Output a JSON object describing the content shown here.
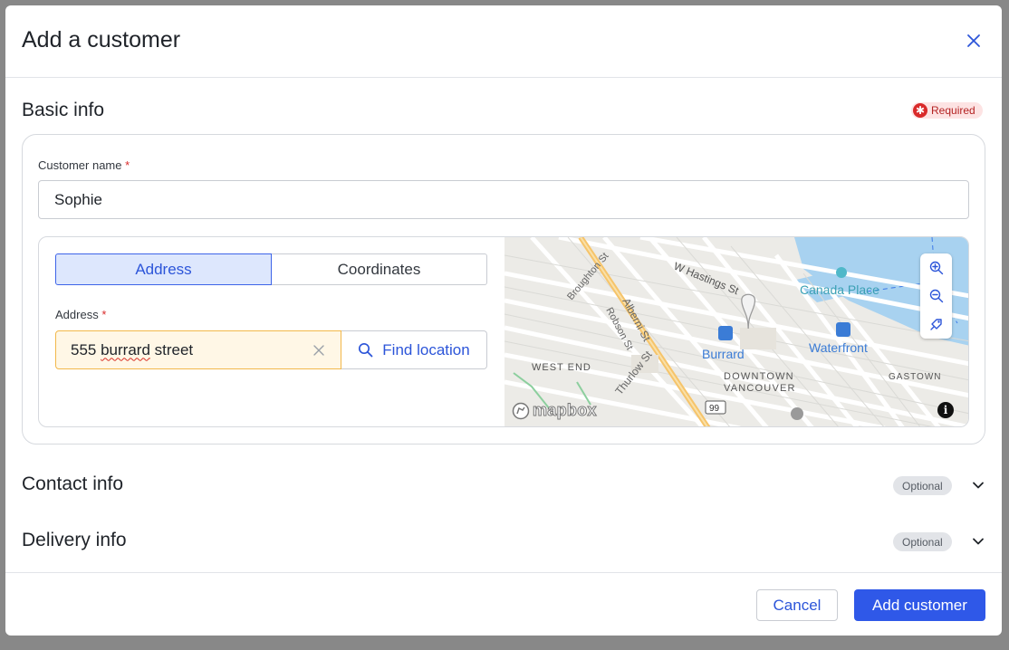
{
  "dialog": {
    "title": "Add a customer",
    "close_icon": "close-icon"
  },
  "basic_info": {
    "title": "Basic info",
    "required_badge": "Required",
    "customer_name": {
      "label": "Customer name",
      "required_mark": "*",
      "value": "Sophie"
    },
    "location_mode": {
      "options": [
        "Address",
        "Coordinates"
      ],
      "selected": "Address"
    },
    "address": {
      "label": "Address",
      "required_mark": "*",
      "value_plain": "555 ",
      "value_misspelled": "burrard",
      "value_rest": " street",
      "find_button": "Find location"
    },
    "map": {
      "labels": {
        "broughton": "Broughton St",
        "hastings": "W Hastings St",
        "canada_place": "Canada Place",
        "alberni": "Alberni St",
        "robson": "Robson St",
        "burrard": "Burrard",
        "waterfront": "Waterfront",
        "west_end": "WEST END",
        "thurlow": "Thurlow St",
        "downtown": "DOWNTOWN",
        "vancouver": "VANCOUVER",
        "gastown": "GASTOWN",
        "route": "99",
        "attribution": "mapbox"
      },
      "controls": [
        "zoom-in-icon",
        "zoom-out-icon",
        "locate-pin-icon"
      ],
      "info_symbol": "i"
    }
  },
  "contact_info": {
    "title": "Contact info",
    "badge": "Optional"
  },
  "delivery_info": {
    "title": "Delivery info",
    "badge": "Optional"
  },
  "footer": {
    "cancel_label": "Cancel",
    "submit_label": "Add customer"
  },
  "colors": {
    "primary": "#2f58e8",
    "required_red": "#d92a2a",
    "address_highlight": "#fff7e6",
    "map_water": "#a8d2f0",
    "map_highway": "#f6c46a"
  }
}
